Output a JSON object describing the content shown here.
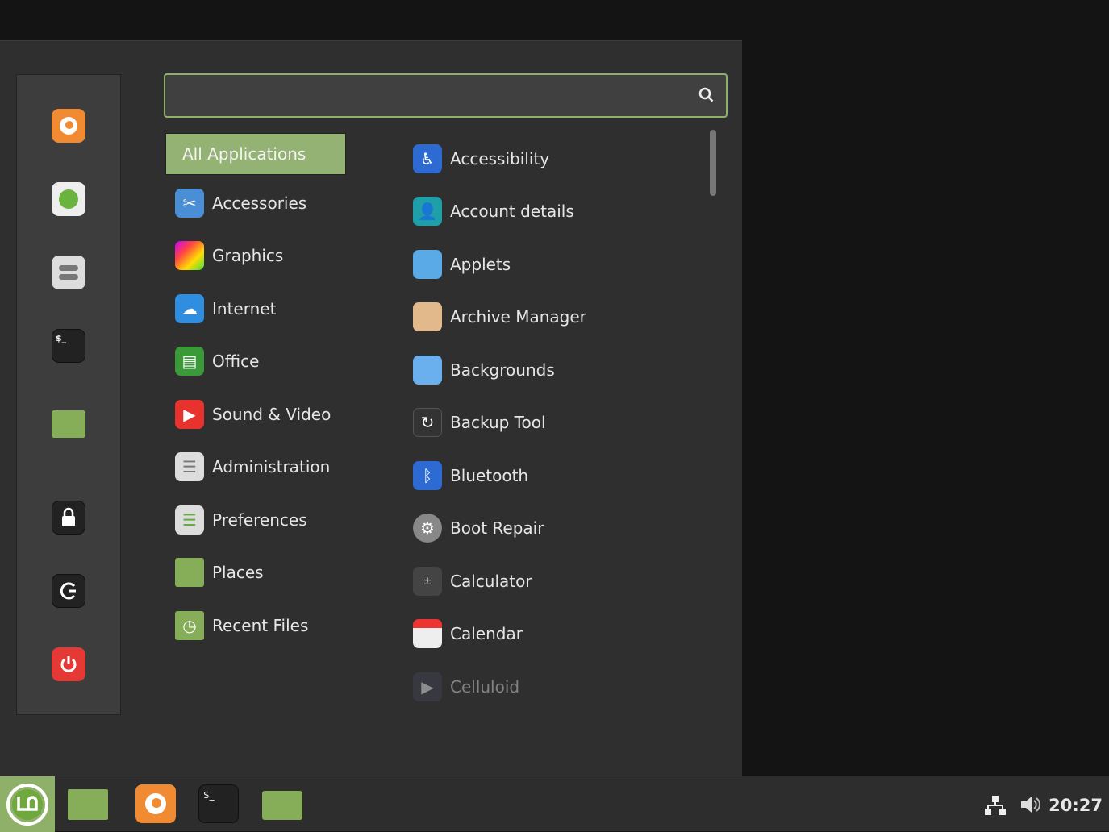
{
  "search": {
    "value": "",
    "placeholder": ""
  },
  "favorites": [
    {
      "name": "firefox",
      "icon": "firefox-icon"
    },
    {
      "name": "software-manager",
      "icon": "software-manager-icon"
    },
    {
      "name": "system-settings",
      "icon": "settings-icon"
    },
    {
      "name": "terminal",
      "icon": "terminal-icon",
      "glyph": "$_"
    },
    {
      "name": "files",
      "icon": "folder-icon"
    },
    {
      "name": "lock-screen",
      "icon": "lock-icon"
    },
    {
      "name": "logout",
      "icon": "logout-icon"
    },
    {
      "name": "quit",
      "icon": "power-icon"
    }
  ],
  "categories": [
    "All Applications",
    "Accessories",
    "Graphics",
    "Internet",
    "Office",
    "Sound & Video",
    "Administration",
    "Preferences",
    "Places",
    "Recent Files"
  ],
  "apps": [
    "Accessibility",
    "Account details",
    "Applets",
    "Archive Manager",
    "Backgrounds",
    "Backup Tool",
    "Bluetooth",
    "Boot Repair",
    "Calculator",
    "Calendar",
    "Celluloid"
  ],
  "taskbar": {
    "terminal_glyph": "$_",
    "clock": "20:27"
  },
  "colors": {
    "accent": "#8fb069",
    "highlight": "#93b273"
  }
}
